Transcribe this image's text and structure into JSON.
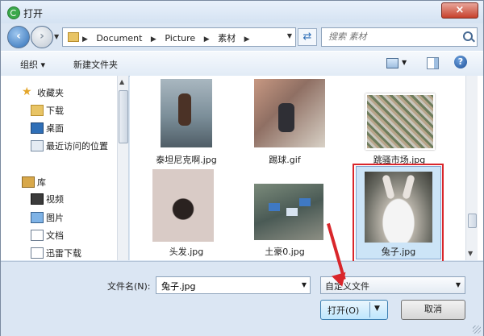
{
  "window": {
    "title": "打开",
    "close_label": "×"
  },
  "address": {
    "crumbs": [
      "Document",
      "Picture",
      "素材"
    ],
    "search_placeholder": "搜索 素材"
  },
  "toolbar": {
    "organize_label": "组织 ▾",
    "new_folder_label": "新建文件夹"
  },
  "nav": {
    "favorites": "收藏夹",
    "favorite_items": [
      "下载",
      "桌面",
      "最近访问的位置"
    ],
    "libraries": "库",
    "library_items": [
      "视频",
      "图片",
      "文档",
      "迅雷下载"
    ]
  },
  "files": [
    {
      "name": "泰坦尼克啊.jpg"
    },
    {
      "name": "踢球.gif"
    },
    {
      "name": "跳骚市场.jpg"
    },
    {
      "name": "头发.jpg"
    },
    {
      "name": "土豪0.jpg"
    },
    {
      "name": "兔子.jpg",
      "selected": true
    }
  ],
  "footer": {
    "filename_label": "文件名(N):",
    "filename_value": "兔子.jpg",
    "filetype_value": "自定义文件",
    "open_label": "打开(O)",
    "cancel_label": "取消"
  },
  "colors": {
    "highlight": "#d9262b",
    "selection": "#cce4f7"
  }
}
